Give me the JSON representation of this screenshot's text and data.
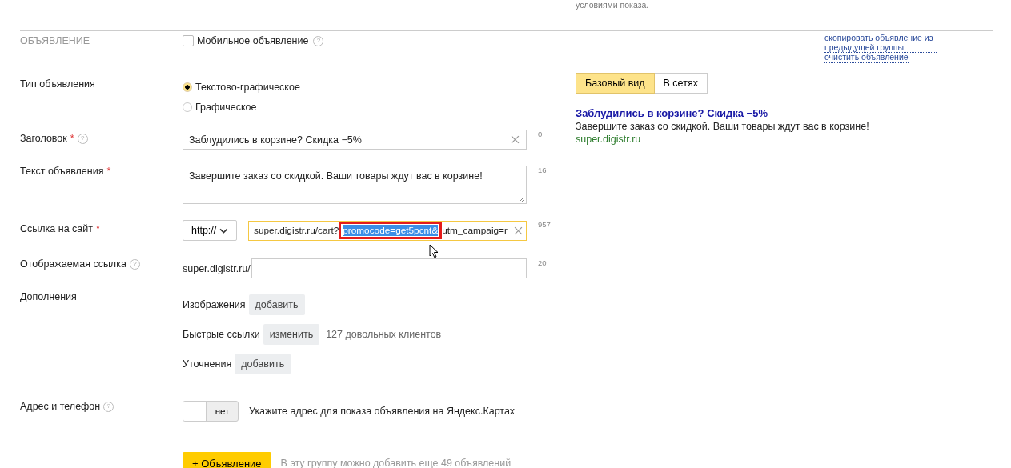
{
  "top_note": "условиями показа.",
  "section": {
    "title": "ОБЪЯВЛЕНИЕ",
    "mobile_checkbox": {
      "label": "Мобильное объявление",
      "checked": false,
      "help": "?"
    }
  },
  "side_links": [
    "скопировать объявление из предыдущей группы",
    "очистить объявление"
  ],
  "ad_type": {
    "label": "Тип объявления",
    "options": [
      {
        "label": "Текстово-графическое",
        "selected": true
      },
      {
        "label": "Графическое",
        "selected": false
      }
    ]
  },
  "title_field": {
    "label": "Заголовок",
    "required": "*",
    "help": "?",
    "value": "Заблудились в корзине? Скидка −5%",
    "counter": "0"
  },
  "text_field": {
    "label": "Текст объявления",
    "required": "*",
    "value": "Завершите заказ со скидкой. Ваши товары ждут вас в корзине!",
    "counter": "16"
  },
  "link_field": {
    "label": "Ссылка на сайт",
    "required": "*",
    "protocol": "http://",
    "value_parts": [
      {
        "text": "super.digistr.ru/cart?",
        "selected": false
      },
      {
        "text": "promocode=get5pcnt&",
        "selected": true
      },
      {
        "text": "utm_campaig=r",
        "selected": false
      }
    ],
    "counter": "957"
  },
  "display_link": {
    "label": "Отображаемая ссылка",
    "help": "?",
    "prefix": "super.digistr.ru/",
    "counter": "20"
  },
  "extras": {
    "label": "Дополнения",
    "items": [
      {
        "label": "Изображения",
        "button": "добавить"
      },
      {
        "label": "Быстрые ссылки",
        "button": "изменить",
        "note": "127 довольных клиентов"
      },
      {
        "label": "Уточнения",
        "button": "добавить"
      }
    ]
  },
  "address": {
    "label": "Адрес и телефон",
    "help": "?",
    "on": false,
    "switch_label": "нет",
    "hint": "Укажите адрес для показа объявления на Яндекс.Картах"
  },
  "add_button": {
    "label": "+ Объявление",
    "hint": "В эту группу можно добавить еще 49 объявлений"
  },
  "preview": {
    "tabs": [
      {
        "label": "Базовый вид",
        "selected": true
      },
      {
        "label": "В сетях",
        "selected": false
      }
    ],
    "title": "Заблудились в корзине? Скидка −5%",
    "text": "Завершите заказ со скидкой. Ваши товары ждут вас в корзине!",
    "url": "super.digistr.ru"
  }
}
